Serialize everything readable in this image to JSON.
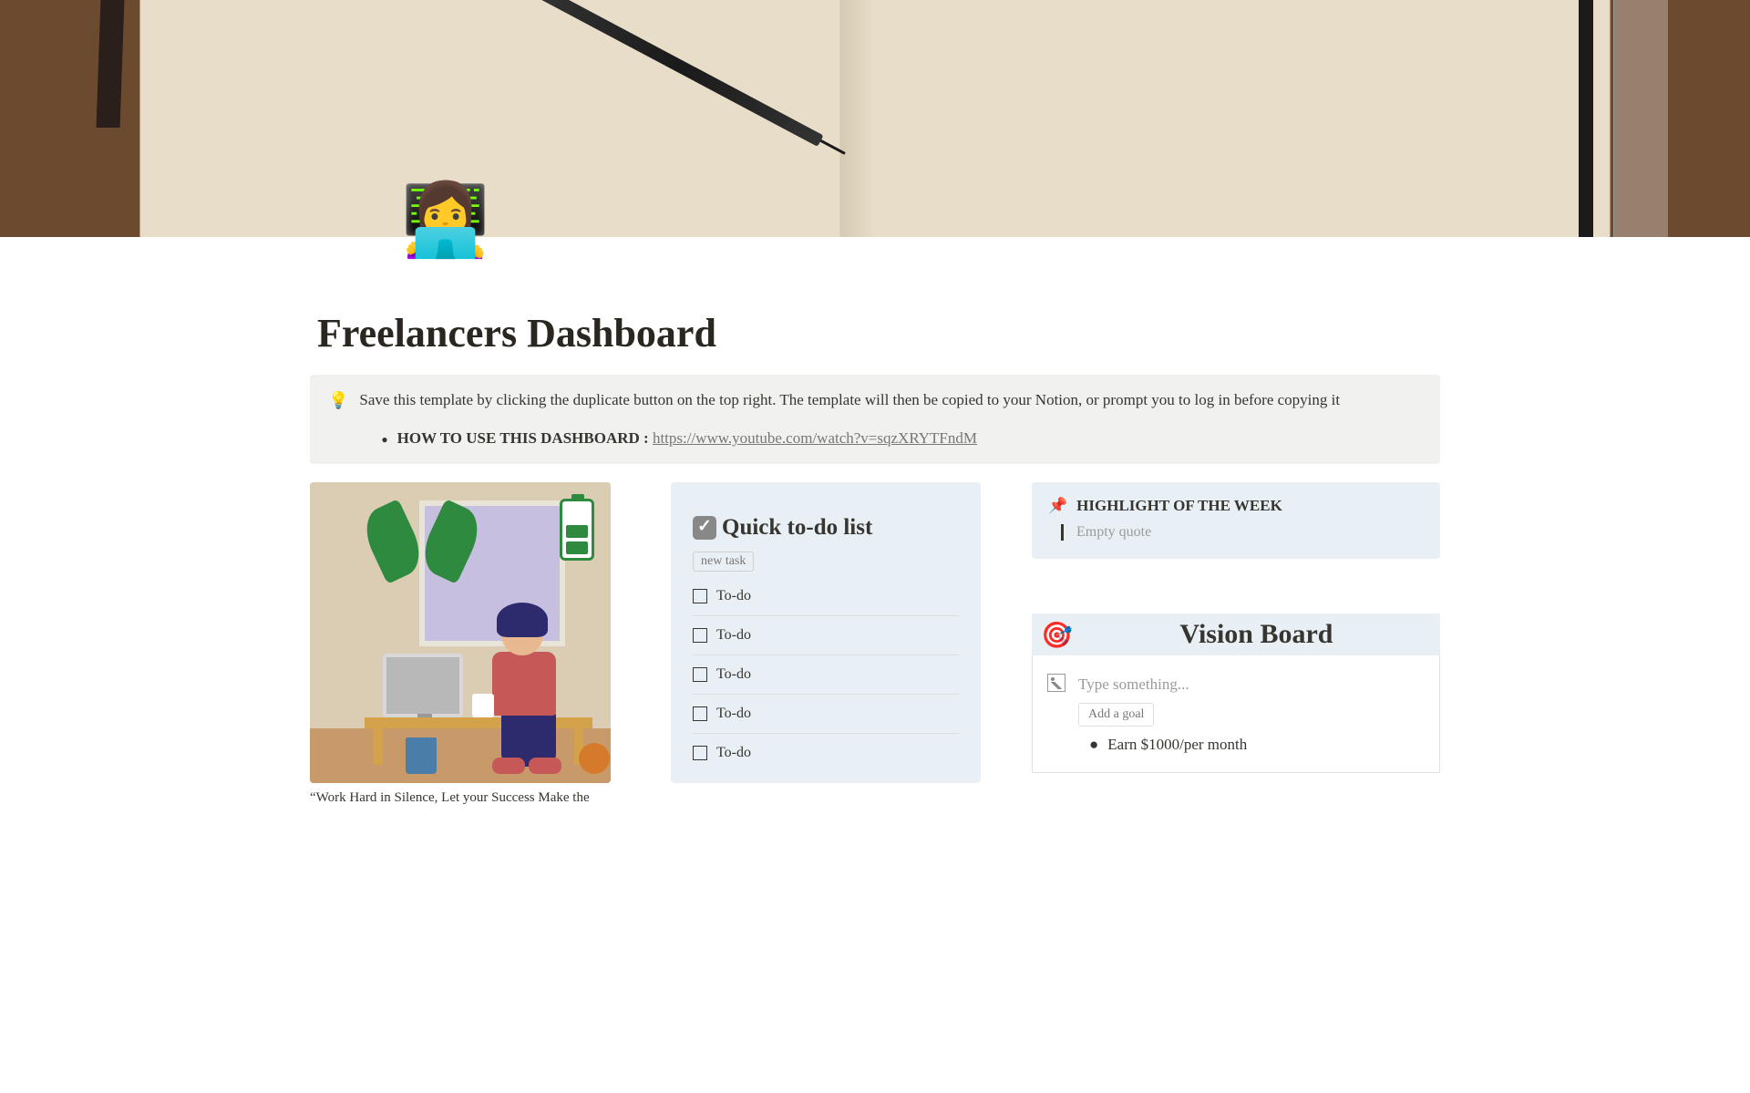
{
  "page": {
    "icon": "👩‍💻",
    "title": "Freelancers Dashboard"
  },
  "callout": {
    "icon": "💡",
    "text": "Save this template by clicking the duplicate button on the top right. The template will then be copied to your Notion, or prompt you to log in before copying it",
    "howto_label": "HOW TO USE THIS DASHBOARD :",
    "howto_link": "https://www.youtube.com/watch?v=sqzXRYTFndM"
  },
  "left_column": {
    "caption": "“Work Hard in Silence, Let your Success Make the"
  },
  "todo": {
    "title": "Quick to-do list",
    "new_task_label": "new task",
    "items": [
      "To-do",
      "To-do",
      "To-do",
      "To-do",
      "To-do"
    ]
  },
  "highlight": {
    "icon": "📌",
    "title": "HIGHLIGHT OF THE WEEK",
    "quote_placeholder": "Empty quote"
  },
  "vision": {
    "icon": "🎯",
    "title": "Vision Board",
    "prompt": "Type something...",
    "add_goal_label": "Add a goal",
    "goal_1": "Earn $1000/per month"
  }
}
